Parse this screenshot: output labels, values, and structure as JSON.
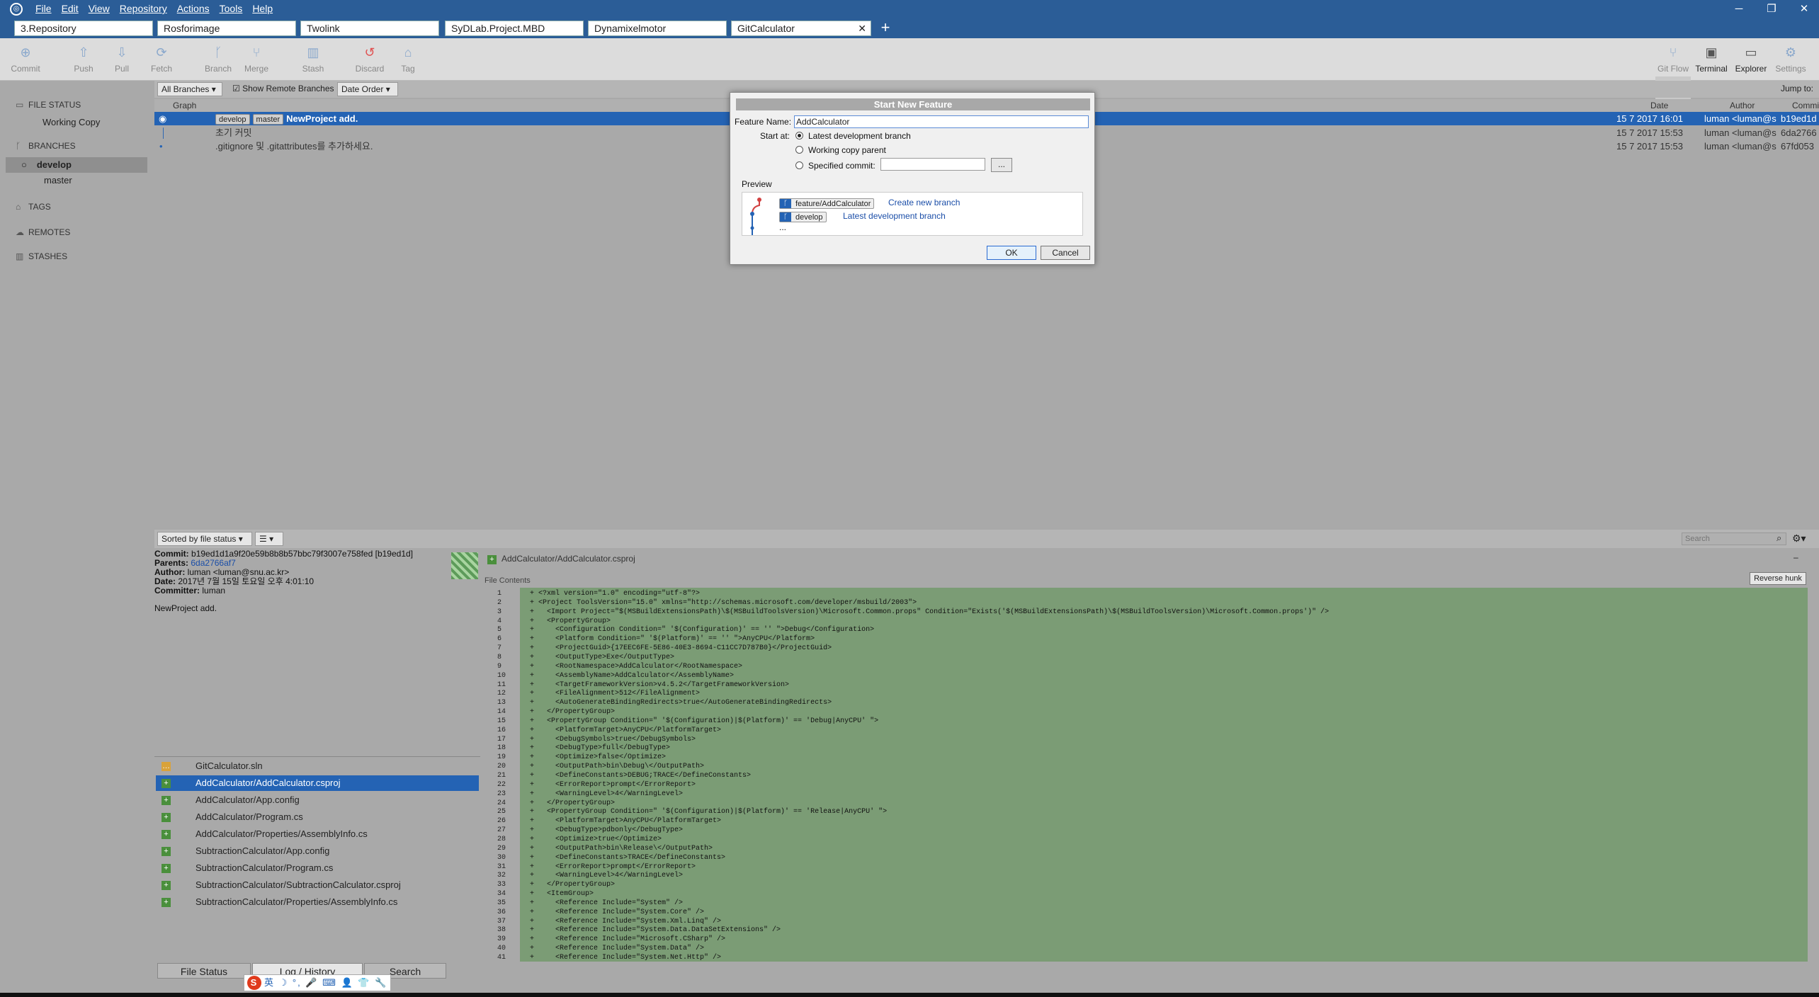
{
  "menu": [
    "File",
    "Edit",
    "View",
    "Repository",
    "Actions",
    "Tools",
    "Help"
  ],
  "tabs": [
    "3.Repository",
    "Rosforimage",
    "Twolink",
    "SyDLab.Project.MBD",
    "Dynamixelmotor",
    "GitCalculator"
  ],
  "tab_close": "✕",
  "tab_add": "+",
  "toolbar": {
    "commit": "Commit",
    "push": "Push",
    "pull": "Pull",
    "fetch": "Fetch",
    "branch": "Branch",
    "merge": "Merge",
    "stash": "Stash",
    "discard": "Discard",
    "tag": "Tag",
    "gitflow": "Git Flow",
    "terminal": "Terminal",
    "explorer": "Explorer",
    "settings": "Settings"
  },
  "sidebar": {
    "file_status": "FILE STATUS",
    "working_copy": "Working Copy",
    "branches": "BRANCHES",
    "develop": "develop",
    "master": "master",
    "tags": "TAGS",
    "remotes": "REMOTES",
    "stashes": "STASHES"
  },
  "filter": {
    "branches": "All Branches",
    "show_remote": "Show Remote Branches",
    "order": "Date Order",
    "jump": "Jump to:"
  },
  "graph_head": {
    "graph": "Graph",
    "date": "Date",
    "author": "Author",
    "commit": "Commit"
  },
  "commits": [
    {
      "tag1": "develop",
      "tag2": "master",
      "msg": "NewProject add.",
      "date": "15 7 2017 16:01",
      "author": "luman <luman@s",
      "hash": "b19ed1d"
    },
    {
      "msg": "초기 커밋",
      "date": "15 7 2017 15:53",
      "author": "luman <luman@s",
      "hash": "6da2766"
    },
    {
      "msg": ".gitignore 및 .gitattributes를 추가하세요.",
      "date": "15 7 2017 15:53",
      "author": "luman <luman@s",
      "hash": "67fd053"
    }
  ],
  "lower": {
    "sort": "Sorted by file status",
    "search_placeholder": "Search"
  },
  "commit_info": {
    "commit_label": "Commit:",
    "commit": "b19ed1d1a9f20e59b8b8b57bbc79f3007e758fed [b19ed1d]",
    "parents_label": "Parents:",
    "parents": "6da2766af7",
    "author_label": "Author:",
    "author": "luman <luman@snu.ac.kr>",
    "date_label": "Date:",
    "date": "2017년 7월 15일 토요일 오후 4:01:10",
    "committer_label": "Committer:",
    "committer": "luman",
    "message": "NewProject add."
  },
  "files": [
    "GitCalculator.sln",
    "AddCalculator/AddCalculator.csproj",
    "AddCalculator/App.config",
    "AddCalculator/Program.cs",
    "AddCalculator/Properties/AssemblyInfo.cs",
    "SubtractionCalculator/App.config",
    "SubtractionCalculator/Program.cs",
    "SubtractionCalculator/SubtractionCalculator.csproj",
    "SubtractionCalculator/Properties/AssemblyInfo.cs"
  ],
  "bottom_tabs": [
    "File Status",
    "Log / History",
    "Search"
  ],
  "diff": {
    "file": "AddCalculator/AddCalculator.csproj",
    "contents_label": "File Contents",
    "reverse_hunk": "Reverse hunk",
    "lines": [
      "<?xml version=\"1.0\" encoding=\"utf-8\"?>",
      "<Project ToolsVersion=\"15.0\" xmlns=\"http://schemas.microsoft.com/developer/msbuild/2003\">",
      "  <Import Project=\"$(MSBuildExtensionsPath)\\$(MSBuildToolsVersion)\\Microsoft.Common.props\" Condition=\"Exists('$(MSBuildExtensionsPath)\\$(MSBuildToolsVersion)\\Microsoft.Common.props')\" />",
      "  <PropertyGroup>",
      "    <Configuration Condition=\" '$(Configuration)' == '' \">Debug</Configuration>",
      "    <Platform Condition=\" '$(Platform)' == '' \">AnyCPU</Platform>",
      "    <ProjectGuid>{17EEC6FE-5E86-40E3-8694-C11CC7D787B0}</ProjectGuid>",
      "    <OutputType>Exe</OutputType>",
      "    <RootNamespace>AddCalculator</RootNamespace>",
      "    <AssemblyName>AddCalculator</AssemblyName>",
      "    <TargetFrameworkVersion>v4.5.2</TargetFrameworkVersion>",
      "    <FileAlignment>512</FileAlignment>",
      "    <AutoGenerateBindingRedirects>true</AutoGenerateBindingRedirects>",
      "  </PropertyGroup>",
      "  <PropertyGroup Condition=\" '$(Configuration)|$(Platform)' == 'Debug|AnyCPU' \">",
      "    <PlatformTarget>AnyCPU</PlatformTarget>",
      "    <DebugSymbols>true</DebugSymbols>",
      "    <DebugType>full</DebugType>",
      "    <Optimize>false</Optimize>",
      "    <OutputPath>bin\\Debug\\</OutputPath>",
      "    <DefineConstants>DEBUG;TRACE</DefineConstants>",
      "    <ErrorReport>prompt</ErrorReport>",
      "    <WarningLevel>4</WarningLevel>",
      "  </PropertyGroup>",
      "  <PropertyGroup Condition=\" '$(Configuration)|$(Platform)' == 'Release|AnyCPU' \">",
      "    <PlatformTarget>AnyCPU</PlatformTarget>",
      "    <DebugType>pdbonly</DebugType>",
      "    <Optimize>true</Optimize>",
      "    <OutputPath>bin\\Release\\</OutputPath>",
      "    <DefineConstants>TRACE</DefineConstants>",
      "    <ErrorReport>prompt</ErrorReport>",
      "    <WarningLevel>4</WarningLevel>",
      "  </PropertyGroup>",
      "  <ItemGroup>",
      "    <Reference Include=\"System\" />",
      "    <Reference Include=\"System.Core\" />",
      "    <Reference Include=\"System.Xml.Linq\" />",
      "    <Reference Include=\"System.Data.DataSetExtensions\" />",
      "    <Reference Include=\"Microsoft.CSharp\" />",
      "    <Reference Include=\"System.Data\" />",
      "    <Reference Include=\"System.Net.Http\" />"
    ]
  },
  "dialog": {
    "title": "Start New Feature",
    "feature_label": "Feature Name:",
    "feature_value": "AddCalculator",
    "start_label": "Start at:",
    "opt1": "Latest development branch",
    "opt2": "Working copy parent",
    "opt3": "Specified commit:",
    "ellipsis": "...",
    "preview": "Preview",
    "pv_branch1": "feature/AddCalculator",
    "pv_link1": "Create new branch",
    "pv_branch2": "develop",
    "pv_link2": "Latest development branch",
    "pv_more": "...",
    "ok": "OK",
    "cancel": "Cancel"
  },
  "ime": {
    "text": "英 ☽ °, 🎤 ⌨ 👤 👕 🔧"
  }
}
